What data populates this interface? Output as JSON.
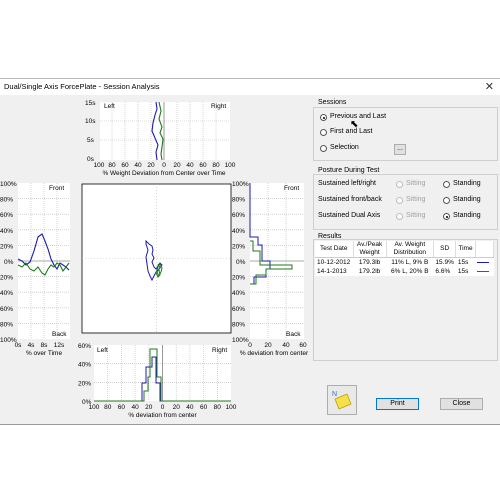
{
  "window": {
    "title": "Dual/Single Axis ForcePlate - Session Analysis",
    "close_glyph": "✕"
  },
  "top_chart": {
    "left_label": "Left",
    "right_label": "Right",
    "y_ticks": [
      "15s",
      "10s",
      "5s",
      "0s"
    ],
    "x_ticks": [
      "100",
      "80",
      "60",
      "40",
      "20",
      "0",
      "20",
      "40",
      "60",
      "80",
      "100"
    ],
    "xlabel": "% Weight Deviation from Center over Time"
  },
  "left_chart": {
    "front_label": "Front",
    "back_label": "Back",
    "y_ticks": [
      "100%",
      "80%",
      "60%",
      "40%",
      "20%",
      "0%",
      "20%",
      "40%",
      "60%",
      "80%",
      "100%"
    ],
    "x_ticks": [
      "0s",
      "4s",
      "8s",
      "12s"
    ],
    "xlabel": "% over Time"
  },
  "right_chart": {
    "front_label": "Front",
    "back_label": "Back",
    "y_ticks": [
      "100%",
      "80%",
      "60%",
      "40%",
      "20%",
      "0%",
      "20%",
      "40%",
      "60%",
      "80%",
      "100%"
    ],
    "x_ticks": [
      "0",
      "20",
      "40",
      "60"
    ],
    "xlabel": "% deviation from center"
  },
  "bottom_chart": {
    "left_label": "Left",
    "right_label": "Right",
    "y_ticks": [
      "60%",
      "40%",
      "20%",
      "0%"
    ],
    "x_ticks": [
      "100",
      "80",
      "60",
      "40",
      "20",
      "0",
      "20",
      "40",
      "60",
      "80",
      "100"
    ],
    "xlabel": "% deviation from center"
  },
  "sessions": {
    "title": "Sessions",
    "options": [
      {
        "label": "Previous and Last",
        "selected": true
      },
      {
        "label": "First and Last",
        "selected": false
      },
      {
        "label": "Selection",
        "selected": false
      }
    ],
    "browse_label": "..."
  },
  "posture": {
    "title": "Posture During Test",
    "rows": [
      {
        "label": "Sustained left/right",
        "sitting": "Sitting",
        "standing": "Standing",
        "selected": "none"
      },
      {
        "label": "Sustained front/back",
        "sitting": "Sitting",
        "standing": "Standing",
        "selected": "none"
      },
      {
        "label": "Sustained Dual Axis",
        "sitting": "Sitting",
        "standing": "Standing",
        "selected": "standing"
      }
    ]
  },
  "results": {
    "title": "Results",
    "headers": [
      "Test Date",
      "Av./Peak Weight",
      "Av. Weight Distribution",
      "SD",
      "Time"
    ],
    "rows": [
      {
        "date": "10-12-2012",
        "weight": "179.3lb",
        "dist": "11% L, 9% B",
        "sd": "15.9%",
        "time": "15s",
        "color": "#1b1bb0"
      },
      {
        "date": "14-1-2013",
        "weight": "179.2lb",
        "dist": "6% L, 20% B",
        "sd": "6.6%",
        "time": "15s",
        "color": "#1d7a1d"
      }
    ]
  },
  "buttons": {
    "print": "Print",
    "close": "Close"
  },
  "colors": {
    "session1": "#1b1bb0",
    "session2": "#1d7a1d"
  },
  "icons": {
    "notes": "sticky-note-icon"
  }
}
